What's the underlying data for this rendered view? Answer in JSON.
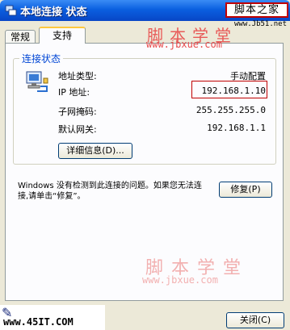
{
  "window": {
    "title": "本地连接 状态"
  },
  "tabs": [
    {
      "label": "常规"
    },
    {
      "label": "支持"
    }
  ],
  "connection_status": {
    "legend": "连接状态",
    "rows": [
      {
        "label": "地址类型:",
        "value": "手动配置"
      },
      {
        "label": "IP 地址:",
        "value": "192.168.1.10"
      },
      {
        "label": "子网掩码:",
        "value": "255.255.255.0"
      },
      {
        "label": "默认网关:",
        "value": "192.168.1.1"
      }
    ],
    "details_button": "详细信息(D)..."
  },
  "repair": {
    "message": "Windows 没有检测到此连接的问题。如果您无法连接,请单击“修复”。",
    "button": "修复(P)"
  },
  "close_button": "关闭(C)",
  "watermarks": {
    "top_box": "脚本之家",
    "top_site": "www.Jb51.net",
    "big_text": "脚本学堂",
    "url": "www.jbxue.com",
    "big_text_2": "脚本学堂",
    "url_2": "www.jbxue.com",
    "footer_site": "www.45IT.COM"
  },
  "colors": {
    "highlight_border": "#c00000",
    "watermark": "#e84b4b",
    "title_bar": "#0a5fe0"
  }
}
